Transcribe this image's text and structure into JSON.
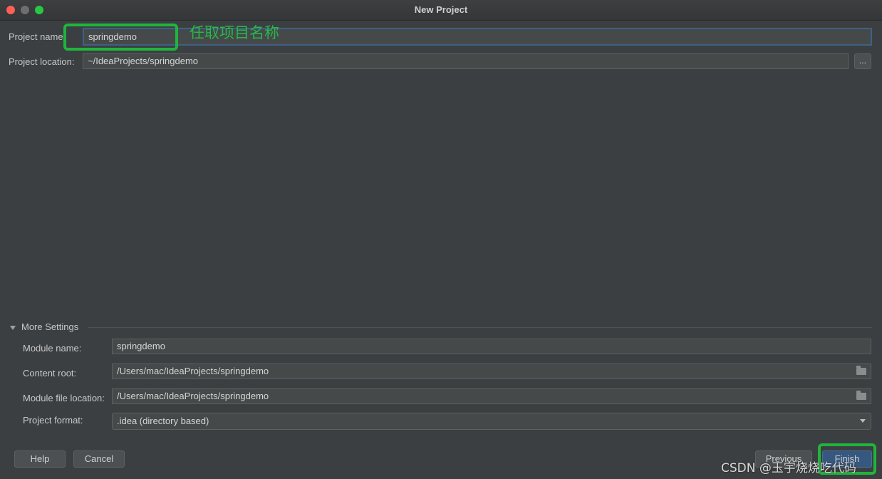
{
  "window": {
    "title": "New Project"
  },
  "project": {
    "name_label": "Project name:",
    "name_value": "springdemo",
    "location_label": "Project location:",
    "location_value": "~/IdeaProjects/springdemo",
    "browse_label": "..."
  },
  "more_settings": {
    "header": "More Settings",
    "module_name_label": "Module name:",
    "module_name_value": "springdemo",
    "content_root_label": "Content root:",
    "content_root_value": "/Users/mac/IdeaProjects/springdemo",
    "module_file_label": "Module file location:",
    "module_file_value": "/Users/mac/IdeaProjects/springdemo",
    "format_label": "Project format:",
    "format_value": ".idea (directory based)"
  },
  "buttons": {
    "help": "Help",
    "cancel": "Cancel",
    "previous": "Previous",
    "finish": "Finish"
  },
  "annotation": {
    "text": "任取项目名称",
    "color": "#1fb53d"
  },
  "watermark": "CSDN @玉宇烧烧吃代码",
  "colors": {
    "background": "#3c3f41",
    "field_bg": "#45494a",
    "focus_border": "#3d6185",
    "primary_button": "#365880"
  }
}
